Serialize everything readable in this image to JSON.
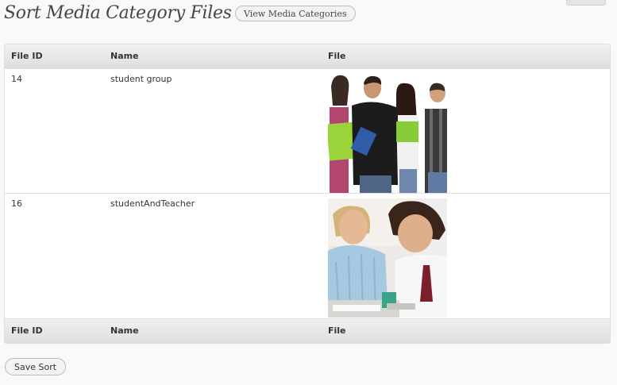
{
  "page": {
    "title": "Sort Media Category Files",
    "view_categories_label": "View Media Categories"
  },
  "table": {
    "header": {
      "file_id": "File ID",
      "name": "Name",
      "file": "File"
    },
    "footer": {
      "file_id": "File ID",
      "name": "Name",
      "file": "File"
    },
    "rows": [
      {
        "file_id": "14",
        "name": "student group",
        "file_image": "photo of a group of four students holding notebooks"
      },
      {
        "file_id": "16",
        "name": "studentAndTeacher",
        "file_image": "photo of a teacher helping a student"
      }
    ]
  },
  "actions": {
    "save_label": "Save Sort"
  }
}
